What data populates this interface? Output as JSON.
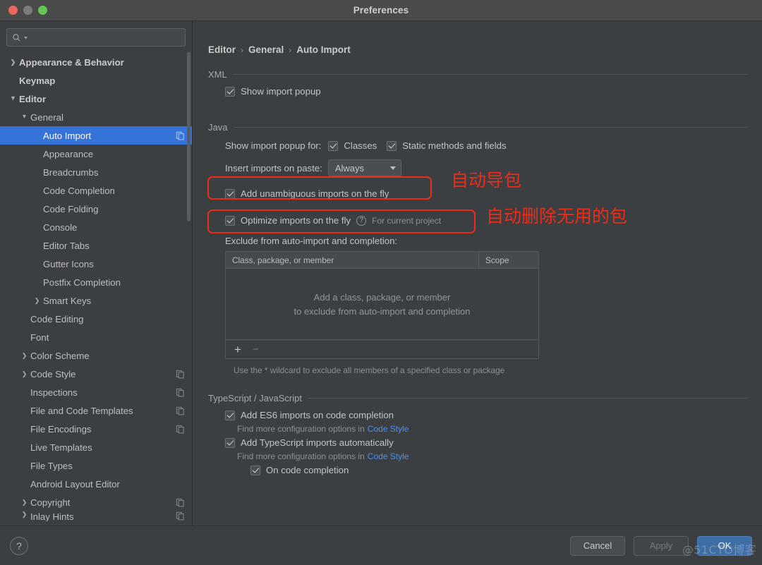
{
  "window": {
    "title": "Preferences",
    "traffic": {
      "close": "close-button",
      "minimize": "minimize-button",
      "zoom": "zoom-button"
    }
  },
  "search": {
    "value": "",
    "placeholder": ""
  },
  "sidebar": {
    "items": [
      {
        "label": "Appearance & Behavior",
        "indent": 0,
        "chev": "›",
        "bold": true,
        "selected": false,
        "copy": false
      },
      {
        "label": "Keymap",
        "indent": 0,
        "chev": "",
        "bold": true,
        "selected": false,
        "copy": false
      },
      {
        "label": "Editor",
        "indent": 0,
        "chev": "⌄",
        "bold": true,
        "selected": false,
        "copy": false
      },
      {
        "label": "General",
        "indent": 1,
        "chev": "⌄",
        "bold": false,
        "selected": false,
        "copy": false
      },
      {
        "label": "Auto Import",
        "indent": 2,
        "chev": "",
        "bold": false,
        "selected": true,
        "copy": true
      },
      {
        "label": "Appearance",
        "indent": 2,
        "chev": "",
        "bold": false,
        "selected": false,
        "copy": false
      },
      {
        "label": "Breadcrumbs",
        "indent": 2,
        "chev": "",
        "bold": false,
        "selected": false,
        "copy": false
      },
      {
        "label": "Code Completion",
        "indent": 2,
        "chev": "",
        "bold": false,
        "selected": false,
        "copy": false
      },
      {
        "label": "Code Folding",
        "indent": 2,
        "chev": "",
        "bold": false,
        "selected": false,
        "copy": false
      },
      {
        "label": "Console",
        "indent": 2,
        "chev": "",
        "bold": false,
        "selected": false,
        "copy": false
      },
      {
        "label": "Editor Tabs",
        "indent": 2,
        "chev": "",
        "bold": false,
        "selected": false,
        "copy": false
      },
      {
        "label": "Gutter Icons",
        "indent": 2,
        "chev": "",
        "bold": false,
        "selected": false,
        "copy": false
      },
      {
        "label": "Postfix Completion",
        "indent": 2,
        "chev": "",
        "bold": false,
        "selected": false,
        "copy": false
      },
      {
        "label": "Smart Keys",
        "indent": 2,
        "chev": "›",
        "bold": false,
        "selected": false,
        "copy": false
      },
      {
        "label": "Code Editing",
        "indent": 1,
        "chev": "",
        "bold": false,
        "selected": false,
        "copy": false
      },
      {
        "label": "Font",
        "indent": 1,
        "chev": "",
        "bold": false,
        "selected": false,
        "copy": false
      },
      {
        "label": "Color Scheme",
        "indent": 1,
        "chev": "›",
        "bold": false,
        "selected": false,
        "copy": false
      },
      {
        "label": "Code Style",
        "indent": 1,
        "chev": "›",
        "bold": false,
        "selected": false,
        "copy": true
      },
      {
        "label": "Inspections",
        "indent": 1,
        "chev": "",
        "bold": false,
        "selected": false,
        "copy": true
      },
      {
        "label": "File and Code Templates",
        "indent": 1,
        "chev": "",
        "bold": false,
        "selected": false,
        "copy": true
      },
      {
        "label": "File Encodings",
        "indent": 1,
        "chev": "",
        "bold": false,
        "selected": false,
        "copy": true
      },
      {
        "label": "Live Templates",
        "indent": 1,
        "chev": "",
        "bold": false,
        "selected": false,
        "copy": false
      },
      {
        "label": "File Types",
        "indent": 1,
        "chev": "",
        "bold": false,
        "selected": false,
        "copy": false
      },
      {
        "label": "Android Layout Editor",
        "indent": 1,
        "chev": "",
        "bold": false,
        "selected": false,
        "copy": false
      },
      {
        "label": "Copyright",
        "indent": 1,
        "chev": "›",
        "bold": false,
        "selected": false,
        "copy": true
      },
      {
        "label": "Inlay Hints",
        "indent": 1,
        "chev": "›",
        "bold": false,
        "selected": false,
        "copy": true
      }
    ]
  },
  "breadcrumb": {
    "part1": "Editor",
    "sep1": "›",
    "part2": "General",
    "sep2": "›",
    "part3": "Auto Import"
  },
  "main": {
    "xml": {
      "section": "XML",
      "show_import_popup": "Show import popup"
    },
    "java": {
      "section": "Java",
      "show_import_popup_for": "Show import popup for:",
      "classes": "Classes",
      "static_methods": "Static methods and fields",
      "insert_imports_label": "Insert imports on paste:",
      "insert_imports_value": "Always",
      "add_unambiguous": "Add unambiguous imports on the fly",
      "optimize_imports": "Optimize imports on the fly",
      "optimize_scope": "For current project",
      "exclude_label": "Exclude from auto-import and completion:",
      "table_col1": "Class, package, or member",
      "table_col2": "Scope",
      "empty_line1": "Add a class, package, or member",
      "empty_line2": "to exclude from auto-import and completion",
      "add_btn": "+",
      "remove_btn": "−",
      "hint": "Use the * wildcard to exclude all members of a specified class or package"
    },
    "ts": {
      "section": "TypeScript / JavaScript",
      "add_es6": "Add ES6 imports on code completion",
      "find_more_1_prefix": "Find more configuration options in",
      "find_more_1_link": "Code Style",
      "add_ts": "Add TypeScript imports automatically",
      "find_more_2_prefix": "Find more configuration options in",
      "find_more_2_link": "Code Style",
      "on_code_completion": "On code completion"
    }
  },
  "annotations": {
    "note1": "自动导包",
    "note2": "自动删除无用的包",
    "color": "#ee2b18"
  },
  "footer": {
    "help": "?",
    "cancel": "Cancel",
    "apply": "Apply",
    "ok": "OK",
    "watermark": "@51CTO博客"
  }
}
